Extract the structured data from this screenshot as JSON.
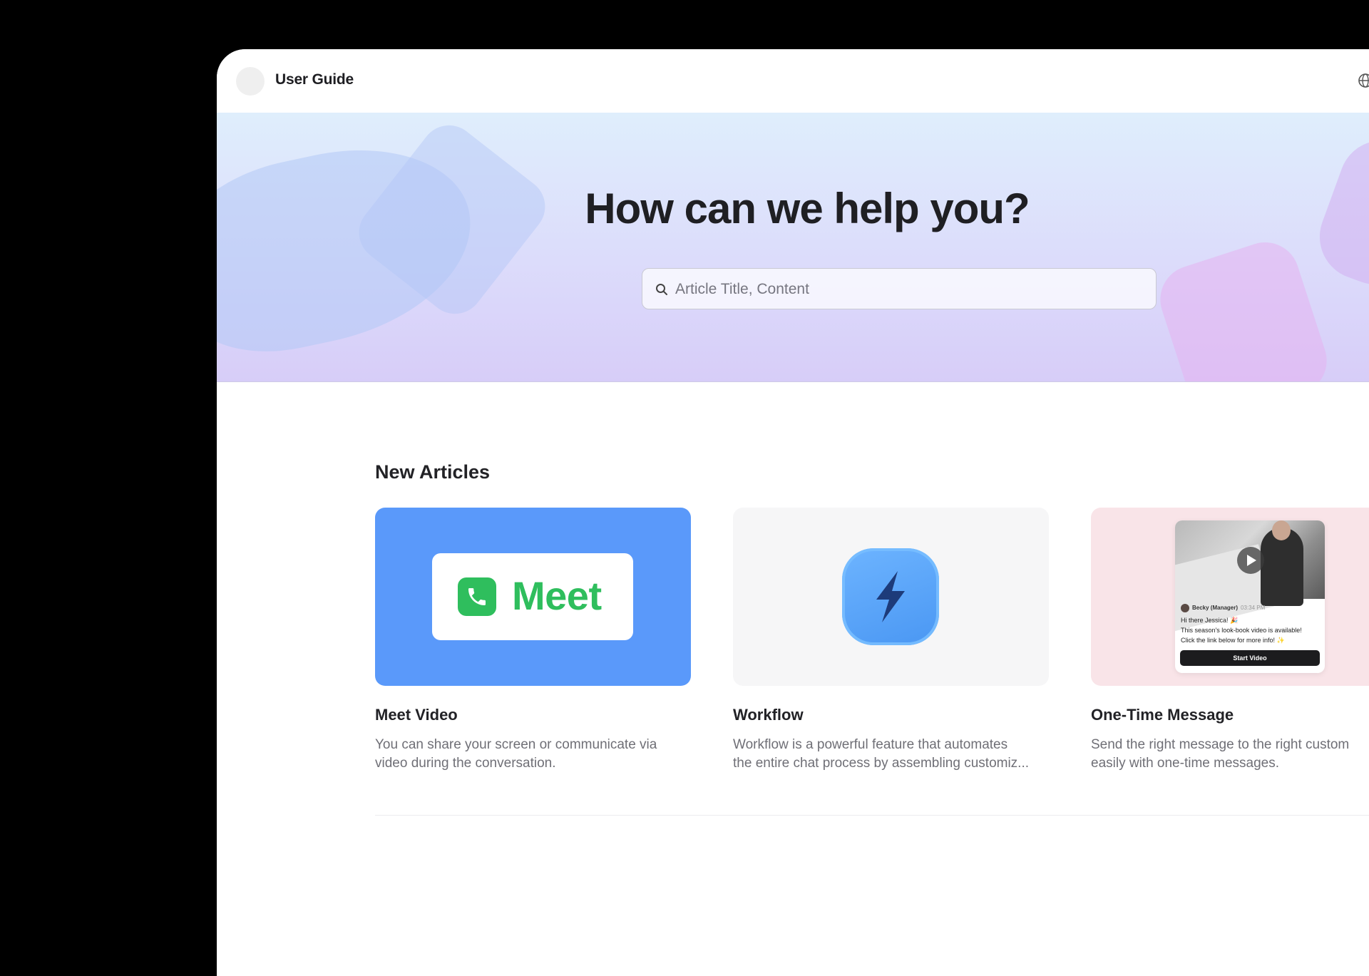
{
  "header": {
    "brand": "User Guide",
    "language_icon": "globe-icon"
  },
  "hero": {
    "title": "How can we help you?",
    "search_placeholder": "Article Title, Content",
    "search_value": "",
    "search_icon": "search-icon"
  },
  "new_articles": {
    "title": "New Articles",
    "items": [
      {
        "title": "Meet Video",
        "desc_line1": "You can share your screen or communicate via",
        "desc_line2": "video during the conversation.",
        "thumb_label": "Meet",
        "thumb_color": "#5a99fa",
        "accent": "#2fbe5d",
        "icon": "phone-icon"
      },
      {
        "title": "Workflow",
        "desc_line1": "Workflow is a powerful feature that automates",
        "desc_line2": "the entire chat process by assembling customiz...",
        "thumb_color": "#f6f6f7",
        "icon": "lightning-icon"
      },
      {
        "title": "One-Time Message",
        "desc_line1": "Send the right message to the right custom",
        "desc_line2": "easily with one-time messages.",
        "thumb_color": "#f9e4e8",
        "preview": {
          "sender": "Becky (Manager)",
          "time": "03:34 PM",
          "line1": "Hi there Jessica! 🎉",
          "line2": "This season's look-book video is available!",
          "line3": "Click the link below for more info! ✨",
          "button": "Start Video"
        }
      }
    ]
  }
}
